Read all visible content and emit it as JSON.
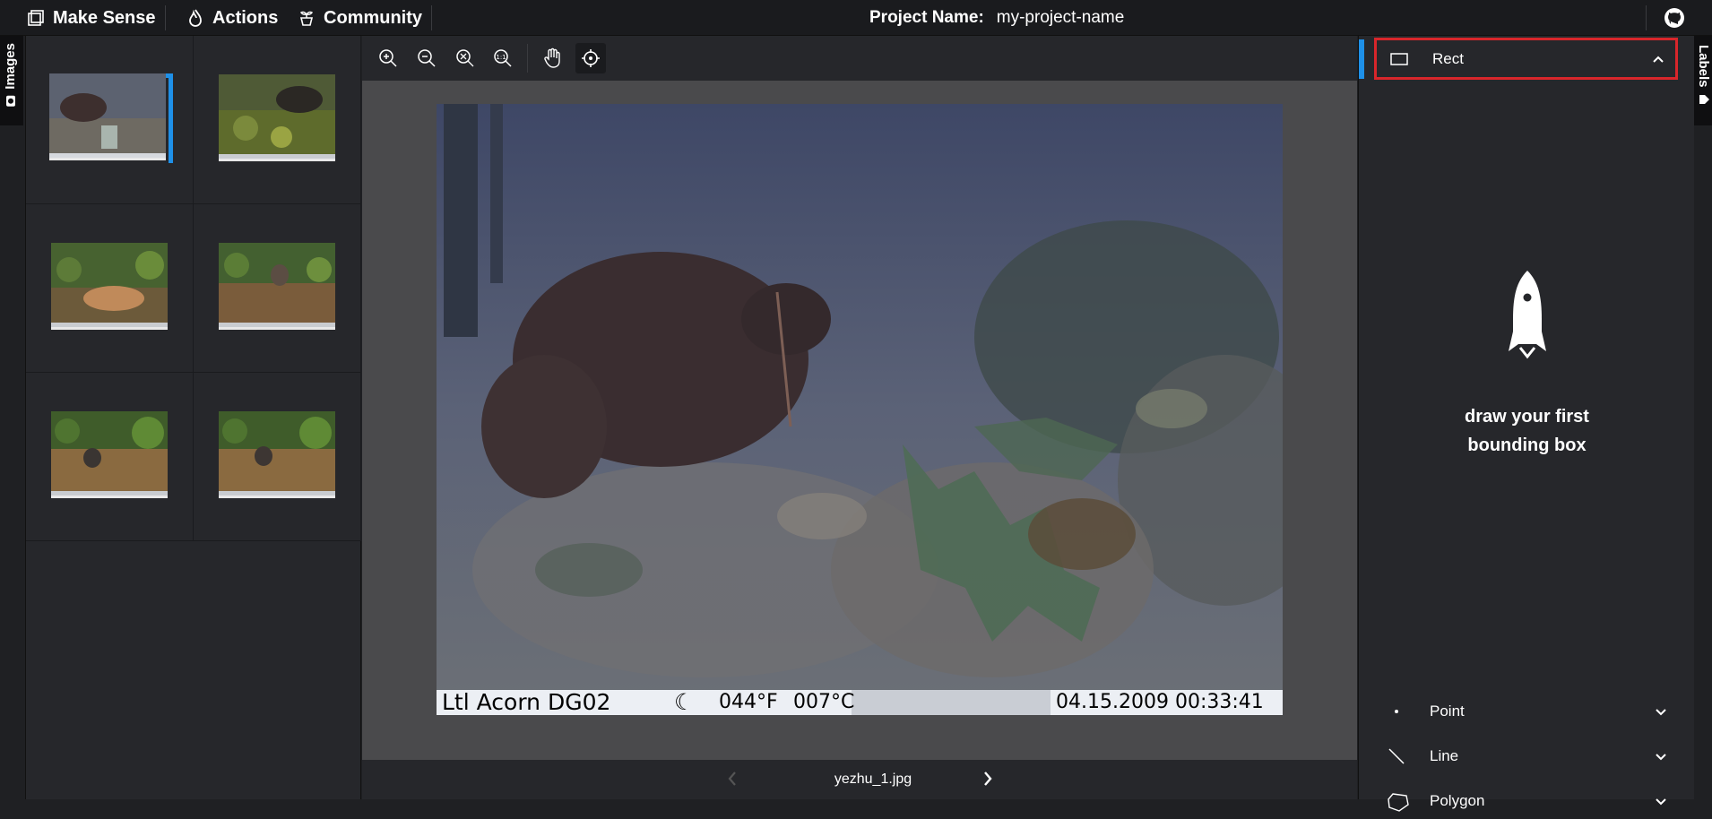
{
  "topbar": {
    "brand": "Make Sense",
    "actions": "Actions",
    "community": "Community",
    "project_label": "Project Name:",
    "project_value": "my-project-name"
  },
  "left_tab": {
    "label": "Images"
  },
  "right_tab": {
    "label": "Labels"
  },
  "thumbnails": [
    {
      "name": "yezhu_1.jpg",
      "active": true
    },
    {
      "name": "thumbnail-2",
      "active": false
    },
    {
      "name": "thumbnail-3",
      "active": false
    },
    {
      "name": "thumbnail-4",
      "active": false
    },
    {
      "name": "thumbnail-5",
      "active": false
    },
    {
      "name": "thumbnail-6",
      "active": false
    }
  ],
  "toolbar": {
    "tools": [
      "zoom-in-icon",
      "zoom-out-icon",
      "zoom-fit-icon",
      "zoom-actual-icon",
      "hand-icon",
      "crosshair-icon"
    ],
    "selected": "crosshair-icon"
  },
  "photo": {
    "caption_left": "Ltl Acorn DG02",
    "caption_temp_f": "044°F",
    "caption_temp_c": "007°C",
    "caption_datetime": "04.15.2009 00:33:41"
  },
  "bottombar": {
    "filename": "yezhu_1.jpg"
  },
  "rpanel": {
    "active_tool": "Rect",
    "empty_line1": "draw your first",
    "empty_line2": "bounding box",
    "tools": [
      {
        "label": "Point",
        "icon": "point-icon"
      },
      {
        "label": "Line",
        "icon": "line-icon"
      },
      {
        "label": "Polygon",
        "icon": "polygon-icon"
      }
    ]
  },
  "colors": {
    "accent": "#1e90e8",
    "highlight": "#d8262b",
    "panel": "#26272b",
    "canvas": "#4a4a4c"
  }
}
